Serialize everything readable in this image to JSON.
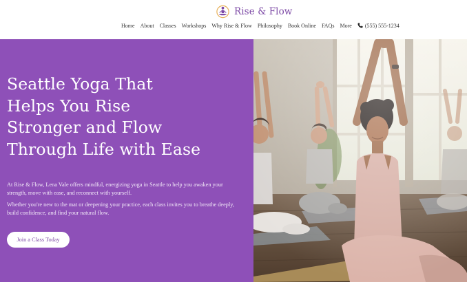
{
  "brand": {
    "name": "Rise & Flow",
    "logo_icon": "meditating-figure-icon",
    "accent_color": "#7d4aa6"
  },
  "nav": {
    "items": [
      "Home",
      "About",
      "Classes",
      "Workshops",
      "Why Rise & Flow",
      "Philosophy",
      "Book Online",
      "FAQs",
      "More"
    ],
    "phone": "(555) 555-1234",
    "phone_icon": "phone-icon"
  },
  "hero": {
    "background_color": "#8e50b8",
    "heading_lines": [
      "Seattle Yoga That",
      "Helps You Rise",
      "Stronger and Flow",
      "Through Life with Ease"
    ],
    "paragraph1": "At Rise & Flow, Lena Vale offers mindful, energizing yoga in Seattle to help you awaken your strength, move with ease, and reconnect with yourself.",
    "paragraph2": "Whether you're new to the mat or deepening your practice, each class invites you to breathe deeply, build confidence, and find your natural flow.",
    "cta_label": "Join a Class Today"
  }
}
